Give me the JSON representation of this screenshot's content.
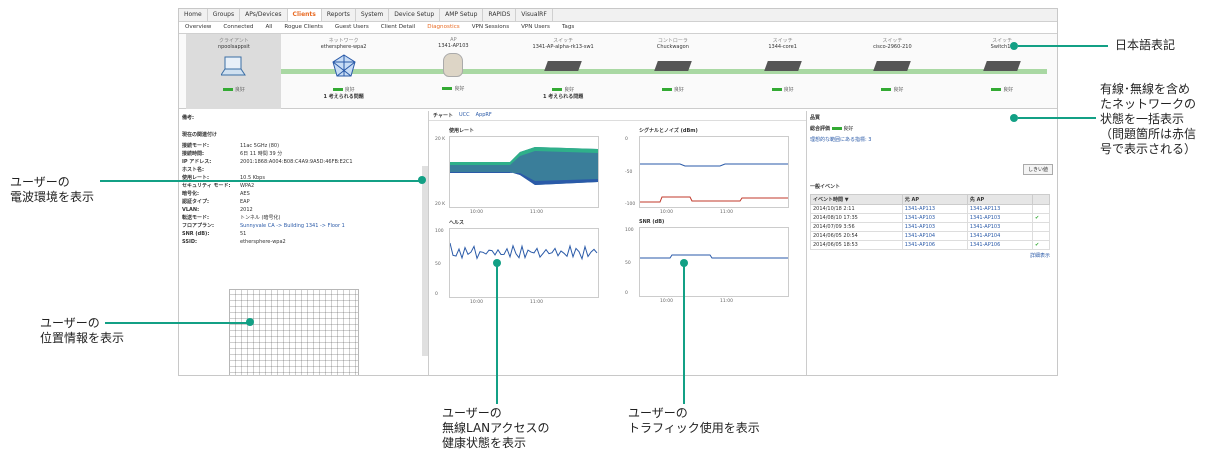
{
  "nav": {
    "tabs": [
      "Home",
      "Groups",
      "APs/Devices",
      "Clients",
      "Reports",
      "System",
      "Device Setup",
      "AMP Setup",
      "RAPIDS",
      "VisualRF"
    ],
    "active_tab": "Clients",
    "subtabs": [
      "Overview",
      "Connected",
      "All",
      "Rogue Clients",
      "Guest Users",
      "Client Detail",
      "Diagnostics",
      "VPN Sessions",
      "VPN Users",
      "Tags"
    ],
    "active_subtab": "Diagnostics"
  },
  "path": [
    {
      "type": "クライアント",
      "name": "npoolsappsit",
      "icon": "laptop-icon",
      "status": "良好",
      "problems": ""
    },
    {
      "type": "ネットワーク",
      "name": "ethersphere-wpa2",
      "icon": "network-icon",
      "status": "良好",
      "problems": "1 考えられる問題"
    },
    {
      "type": "AP",
      "name": "1341-AP103",
      "icon": "access-point-icon",
      "status": "良好",
      "problems": ""
    },
    {
      "type": "スイッチ",
      "name": "1341-AP-alpha-rk13-sw1",
      "icon": "switch-icon",
      "status": "良好",
      "problems": "1 考えられる問題"
    },
    {
      "type": "コントローラ",
      "name": "Chuckwagon",
      "icon": "controller-icon",
      "status": "良好",
      "problems": ""
    },
    {
      "type": "スイッチ",
      "name": "1344-core1",
      "icon": "switch-icon",
      "status": "良好",
      "problems": ""
    },
    {
      "type": "スイッチ",
      "name": "cisco-2960-210",
      "icon": "switch-icon",
      "status": "良好",
      "problems": ""
    },
    {
      "type": "スイッチ",
      "name": "Switch15",
      "icon": "switch-icon",
      "status": "良好",
      "problems": ""
    }
  ],
  "left": {
    "notes_label": "備考:",
    "section": "現在の関連付け",
    "rows": [
      {
        "k": "接続モード:",
        "v": "11ac 5GHz (80)"
      },
      {
        "k": "接続時間:",
        "v": "6日 11 時間 39 分"
      },
      {
        "k": "IP アドレス:",
        "v": "2001:1868:A004:B08:C4A9:9A5D:46FB:E2C1"
      },
      {
        "k": "ホスト名:",
        "v": ""
      },
      {
        "k": "使用レート:",
        "v": "10.5 Kbps"
      },
      {
        "k": "セキュリティ モード:",
        "v": "WPA2"
      },
      {
        "k": "暗号化:",
        "v": "AES"
      },
      {
        "k": "認証タイプ:",
        "v": "EAP"
      },
      {
        "k": "VLAN:",
        "v": "2012"
      },
      {
        "k": "転送モード:",
        "v": "トンネル (暗号化)"
      },
      {
        "k": "フロアプラン:",
        "v": "Sunnyvale CA -> Building 1341 -> Floor 1"
      },
      {
        "k": "SNR (dB):",
        "v": "51"
      },
      {
        "k": "SSID:",
        "v": "ethersphere-wpa2"
      }
    ]
  },
  "middle": {
    "tab_chart": "チャート",
    "tab_ucc": "UCC",
    "tab_apprf": "AppRF",
    "charts": [
      {
        "title": "使用レート",
        "ymax": "20 K",
        "ymin": "20 K",
        "x1": "10:00",
        "x2": "11:00"
      },
      {
        "title": "シグナルとノイズ (dBm)",
        "ymax": "0",
        "ymid": "-50",
        "ymin": "-100",
        "x1": "10:00",
        "x2": "11:00"
      },
      {
        "title": "ヘルス",
        "ymax": "100",
        "ymid": "50",
        "ymin": "0",
        "x1": "10:00",
        "x2": "11:00"
      },
      {
        "title": "SNR (dB)",
        "ymax": "100",
        "ymid": "50",
        "ymin": "0",
        "x1": "10:00",
        "x2": "11:00"
      }
    ]
  },
  "right": {
    "title": "品質",
    "overall_label": "総合評価",
    "overall_value": "良好",
    "range_link": "理想的な範囲にある指標: 3",
    "button": "しきい値",
    "events_title": "一般イベント",
    "headers": [
      "イベント時間",
      "元 AP",
      "先 AP"
    ],
    "events": [
      {
        "time": "2014/10/18 2:11",
        "from": "1341-AP113",
        "to": "1341-AP113",
        "ok": false
      },
      {
        "time": "2014/08/10 17:35",
        "from": "1341-AP103",
        "to": "1341-AP103",
        "ok": true
      },
      {
        "time": "2014/07/09 3:56",
        "from": "1341-AP103",
        "to": "1341-AP103",
        "ok": false
      },
      {
        "time": "2014/06/05 20:54",
        "from": "1341-AP104",
        "to": "1341-AP104",
        "ok": false
      },
      {
        "time": "2014/06/05 18:53",
        "from": "1341-AP106",
        "to": "1341-AP106",
        "ok": true
      }
    ],
    "more": "詳細表示"
  },
  "annotations": {
    "jp_notation": "日本語表記",
    "network_status": [
      "有線･無線を含め",
      "たネットワークの",
      "状態を一括表示",
      "（問題箇所は赤信",
      "号で表示される）"
    ],
    "radio_env": [
      "ユーザーの",
      "電波環境を表示"
    ],
    "location": [
      "ユーザーの",
      "位置情報を表示"
    ],
    "health": [
      "ユーザーの",
      "無線LANアクセスの",
      "健康状態を表示"
    ],
    "traffic": [
      "ユーザーの",
      "トラフィック使用を表示"
    ]
  },
  "colors": {
    "accent": "#e86b24",
    "callout": "#13a085",
    "ok": "#33aa33"
  }
}
